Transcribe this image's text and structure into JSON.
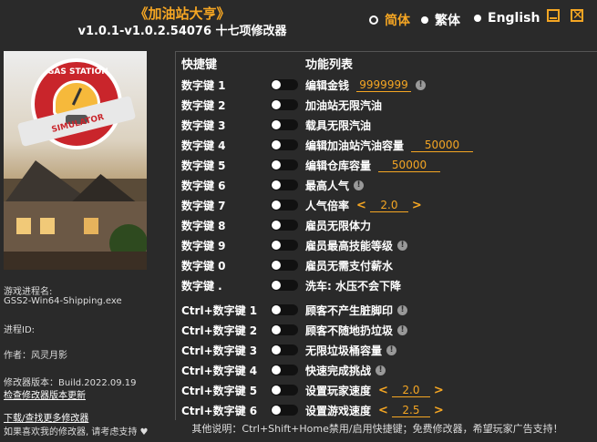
{
  "header": {
    "title": "《加油站大亨》",
    "subtitle": "v1.0.1-v1.0.2.54076 十七项修改器"
  },
  "languages": [
    {
      "label": "简体",
      "active": true
    },
    {
      "label": "繁体",
      "active": false
    },
    {
      "label": "English",
      "active": false
    }
  ],
  "window_buttons": {
    "minimize_icon": "minimize-icon",
    "close_icon": "close-icon"
  },
  "cover": {
    "logo_line1": "GAS STATION",
    "logo_line2": "SIMULATOR"
  },
  "info": {
    "process_label": "游戏进程名:",
    "process_value": "GSS2-Win64-Shipping.exe",
    "pid_label": "进程ID:",
    "author": "作者：风灵月影",
    "version": "修改器版本：Build.2022.09.19",
    "check_update": "检查修改器版本更新",
    "download_more": "下载/查找更多修改器",
    "support": "如果喜欢我的修改器, 请考虑支持 ♥"
  },
  "columns": {
    "hotkey": "快捷键",
    "functions": "功能列表"
  },
  "cheats": [
    {
      "key": "数字键 1",
      "label": "编辑金钱",
      "value": "9999999",
      "info": true
    },
    {
      "key": "数字键 2",
      "label": "加油站无限汽油"
    },
    {
      "key": "数字键 3",
      "label": "载具无限汽油"
    },
    {
      "key": "数字键 4",
      "label": "编辑加油站汽油容量",
      "value": "50000"
    },
    {
      "key": "数字键 5",
      "label": "编辑仓库容量",
      "value": "50000"
    },
    {
      "key": "数字键 6",
      "label": "最高人气",
      "info": true
    },
    {
      "key": "数字键 7",
      "label": "人气倍率",
      "stepper": "2.0"
    },
    {
      "key": "数字键 8",
      "label": "雇员无限体力"
    },
    {
      "key": "数字键 9",
      "label": "雇员最高技能等级",
      "info": true
    },
    {
      "key": "数字键 0",
      "label": "雇员无需支付薪水"
    },
    {
      "key": "数字键 .",
      "label": "洗车: 水压不会下降"
    },
    {
      "key": "Ctrl+数字键 1",
      "label": "顾客不产生脏脚印",
      "info": true
    },
    {
      "key": "Ctrl+数字键 2",
      "label": "顾客不随地扔垃圾",
      "info": true
    },
    {
      "key": "Ctrl+数字键 3",
      "label": "无限垃圾桶容量",
      "info": true
    },
    {
      "key": "Ctrl+数字键 4",
      "label": "快速完成挑战",
      "info": true
    },
    {
      "key": "Ctrl+数字键 5",
      "label": "设置玩家速度",
      "stepper": "2.0"
    },
    {
      "key": "Ctrl+数字键 6",
      "label": "设置游戏速度",
      "stepper": "2.5"
    }
  ],
  "footer": "其他说明：Ctrl+Shift+Home禁用/启用快捷键；免费修改器，希望玩家广告支持！"
}
